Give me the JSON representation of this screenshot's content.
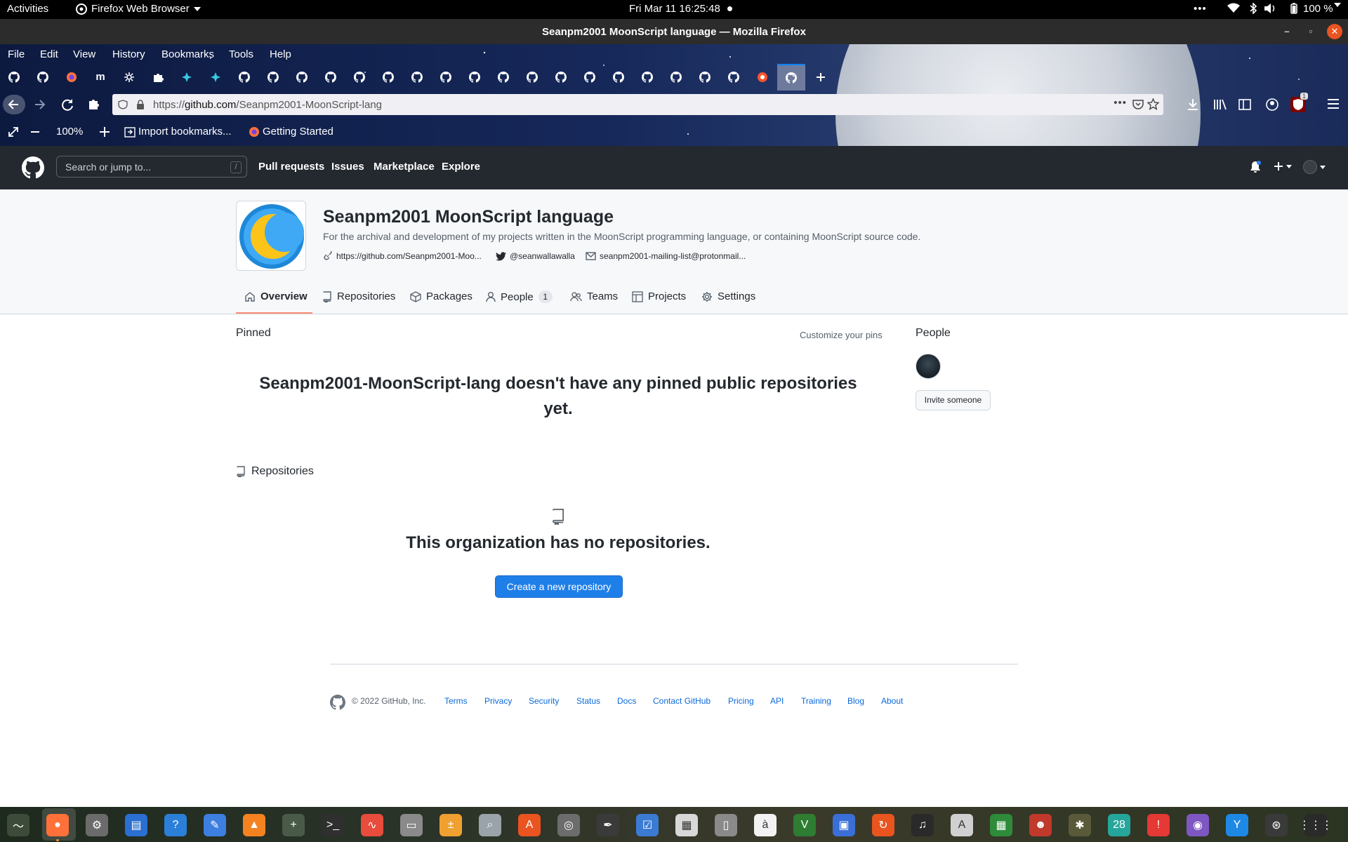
{
  "system": {
    "activities": "Activities",
    "app_menu": "Firefox Web Browser",
    "clock": "Fri Mar 11  16:25:48",
    "battery": "100 %"
  },
  "window": {
    "title": "Seanpm2001 MoonScript language — Mozilla Firefox"
  },
  "menu": [
    "File",
    "Edit",
    "View",
    "History",
    "Bookmarks",
    "Tools",
    "Help"
  ],
  "browser": {
    "url_prefix": "https://",
    "url_host": "github.com",
    "url_path": "/Seanpm2001-MoonScript-lang",
    "zoom": "100%",
    "bookmarks": [
      {
        "label": "Import bookmarks..."
      },
      {
        "label": "Getting Started"
      }
    ],
    "notification_badge": "1"
  },
  "github": {
    "search_placeholder": "Search or jump to...",
    "search_key": "/",
    "nav": [
      "Pull requests",
      "Issues",
      "Marketplace",
      "Explore"
    ]
  },
  "org": {
    "name": "Seanpm2001 MoonScript language",
    "description": "For the archival and development of my projects written in the MoonScript programming language, or containing MoonScript source code.",
    "website": "https://github.com/Seanpm2001-Moo...",
    "twitter": "@seanwallawalla",
    "email": "seanpm2001-mailing-list@protonmail...",
    "tabs": [
      {
        "label": "Overview"
      },
      {
        "label": "Repositories"
      },
      {
        "label": "Packages"
      },
      {
        "label": "People",
        "count": "1"
      },
      {
        "label": "Teams"
      },
      {
        "label": "Projects"
      },
      {
        "label": "Settings"
      }
    ]
  },
  "main": {
    "pinned_title": "Pinned",
    "customize_pins": "Customize your pins",
    "no_pinned_line1": "Seanpm2001-MoonScript-lang doesn't have any pinned public repositories",
    "no_pinned_line2": "yet.",
    "repos_title": "Repositories",
    "no_repos": "This organization has no repositories.",
    "create_button": "Create a new repository",
    "people_title": "People",
    "invite_button": "Invite someone"
  },
  "footer": {
    "copyright": "© 2022 GitHub, Inc.",
    "links": [
      "Terms",
      "Privacy",
      "Security",
      "Status",
      "Docs",
      "Contact GitHub",
      "Pricing",
      "API",
      "Training",
      "Blog",
      "About"
    ]
  },
  "dock": {
    "calendar_day": "28"
  },
  "colors": {
    "github_header": "#24292f",
    "link": "#0969da",
    "primary_button": "#1f7fe8",
    "active_tab_underline": "#fd8c73"
  }
}
